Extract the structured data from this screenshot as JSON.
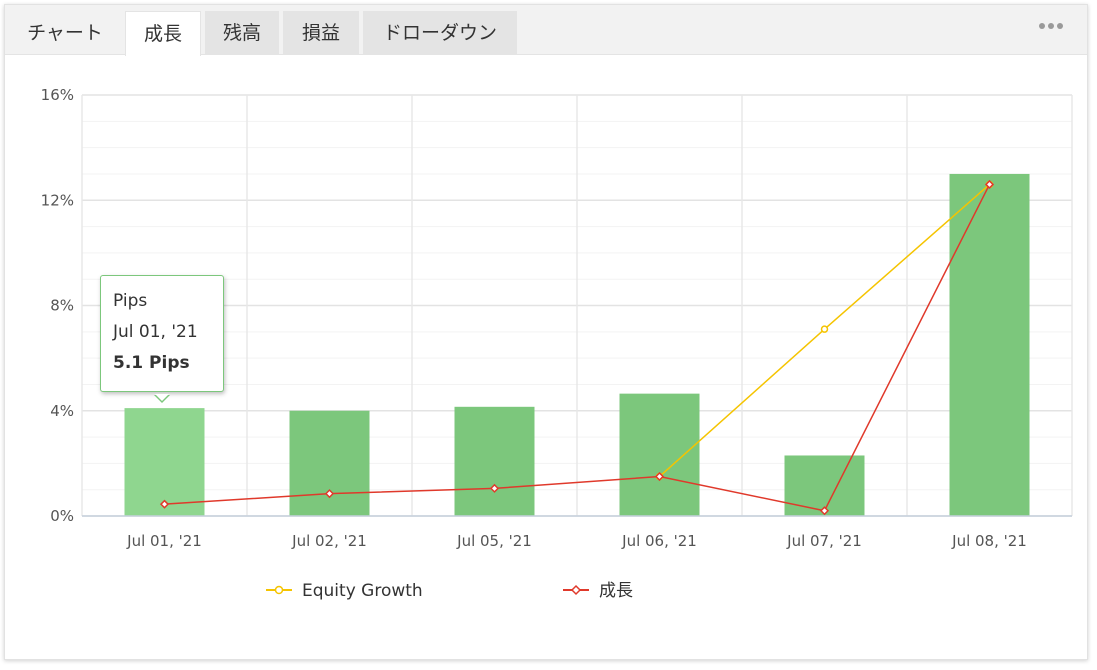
{
  "tabs": [
    {
      "label": "チャート",
      "active": false
    },
    {
      "label": "成長",
      "active": true
    },
    {
      "label": "残高",
      "active": false
    },
    {
      "label": "損益",
      "active": false
    },
    {
      "label": "ドローダウン",
      "active": false
    }
  ],
  "more_icon": "more-dots-icon",
  "tooltip": {
    "title": "Pips",
    "date": "Jul 01, '21",
    "value": "5.1 Pips"
  },
  "chart_data": {
    "type": "bar",
    "categories": [
      "Jul 01, '21",
      "Jul 02, '21",
      "Jul 05, '21",
      "Jul 06, '21",
      "Jul 07, '21",
      "Jul 08, '21"
    ],
    "ylim": [
      0,
      16
    ],
    "yticks": [
      "0%",
      "4%",
      "8%",
      "12%",
      "16%"
    ],
    "grid": true,
    "legend_position": "bottom",
    "series": [
      {
        "name": "Pips",
        "type": "bar",
        "color": "#7cc77c",
        "values": [
          4.1,
          4.0,
          4.15,
          4.65,
          2.3,
          13.0
        ]
      },
      {
        "name": "Equity Growth",
        "type": "line",
        "color": "#f5c400",
        "values": [
          null,
          null,
          null,
          1.5,
          7.1,
          12.6
        ]
      },
      {
        "name": "成長",
        "type": "line",
        "color": "#e0392b",
        "values": [
          0.45,
          0.85,
          1.05,
          1.5,
          0.2,
          12.6
        ]
      }
    ],
    "legend": [
      "Equity Growth",
      "成長"
    ]
  }
}
